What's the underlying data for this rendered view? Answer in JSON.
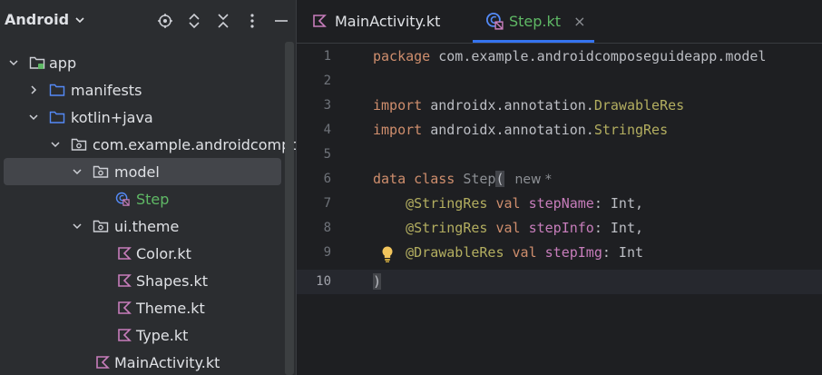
{
  "project": {
    "view_title": "Android",
    "tree": [
      {
        "label": "app",
        "icon": "module-folder-icon"
      },
      {
        "label": "manifests",
        "icon": "folder-icon"
      },
      {
        "label": "kotlin+java",
        "icon": "folder-icon"
      },
      {
        "label": "com.example.androidcompos",
        "icon": "package-icon"
      },
      {
        "label": "model",
        "icon": "package-icon"
      },
      {
        "label": "Step",
        "icon": "kotlin-class-icon"
      },
      {
        "label": "ui.theme",
        "icon": "package-icon"
      },
      {
        "label": "Color.kt",
        "icon": "kotlin-file-icon"
      },
      {
        "label": "Shapes.kt",
        "icon": "kotlin-file-icon"
      },
      {
        "label": "Theme.kt",
        "icon": "kotlin-file-icon"
      },
      {
        "label": "Type.kt",
        "icon": "kotlin-file-icon"
      },
      {
        "label": "MainActivity.kt",
        "icon": "kotlin-file-icon"
      }
    ]
  },
  "editor": {
    "tabs": [
      {
        "label": "MainActivity.kt",
        "icon": "kotlin-file-icon"
      },
      {
        "label": "Step.kt",
        "icon": "kotlin-class-icon",
        "close": "×"
      }
    ],
    "line_numbers": [
      "1",
      "2",
      "3",
      "4",
      "5",
      "6",
      "7",
      "8",
      "9",
      "10"
    ],
    "code": {
      "l1_kw": "package",
      "l1_rest": " com.example.androidcomposeguideapp.model",
      "l3_kw": "import",
      "l3_pkg": " androidx.annotation.",
      "l3_ann": "DrawableRes",
      "l4_kw": "import",
      "l4_pkg": " androidx.annotation.",
      "l4_ann": "StringRes",
      "l6_kw": "data class",
      "l6_name": " Step",
      "l6_paren": "(",
      "l6_hint": "new *",
      "l7_ann": "@StringRes",
      "l7_kw": " val",
      "l7_prop": " stepName",
      "l7_rest": ": Int,",
      "l8_ann": "@StringRes",
      "l8_kw": " val",
      "l8_prop": " stepInfo",
      "l8_rest": ": Int,",
      "l9_ann": "@DrawableRes",
      "l9_kw": " val",
      "l9_prop": " stepImg",
      "l9_rest": ": Int",
      "l10": ")"
    }
  },
  "colors": {
    "accent": "#3574f0",
    "keyword": "#cf8e6d",
    "annotation": "#b3ae60",
    "property": "#c77dbb",
    "class_name_green": "#5fb865"
  }
}
